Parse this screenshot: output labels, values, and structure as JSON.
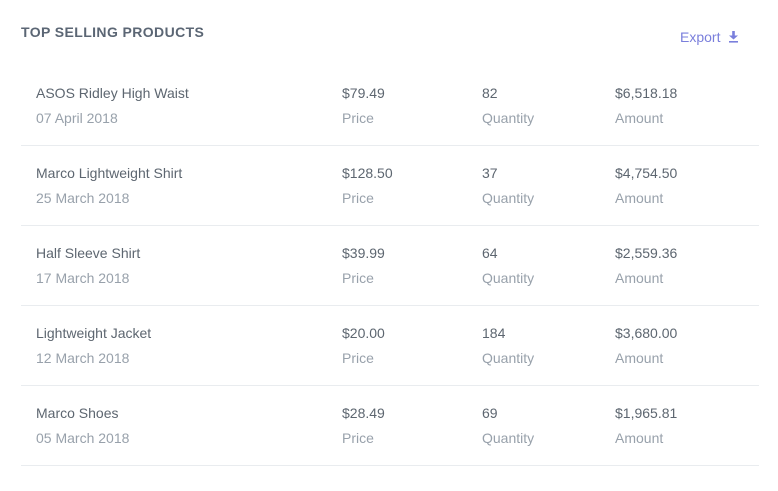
{
  "header": {
    "title": "TOP SELLING PRODUCTS",
    "export_label": "Export"
  },
  "products": [
    {
      "name": "ASOS Ridley High Waist",
      "date": "07 April 2018",
      "price": "$79.49",
      "price_label": "Price",
      "quantity": "82",
      "quantity_label": "Quantity",
      "amount": "$6,518.18",
      "amount_label": "Amount"
    },
    {
      "name": "Marco Lightweight Shirt",
      "date": "25 March 2018",
      "price": "$128.50",
      "price_label": "Price",
      "quantity": "37",
      "quantity_label": "Quantity",
      "amount": "$4,754.50",
      "amount_label": "Amount"
    },
    {
      "name": "Half Sleeve Shirt",
      "date": "17 March 2018",
      "price": "$39.99",
      "price_label": "Price",
      "quantity": "64",
      "quantity_label": "Quantity",
      "amount": "$2,559.36",
      "amount_label": "Amount"
    },
    {
      "name": "Lightweight Jacket",
      "date": "12 March 2018",
      "price": "$20.00",
      "price_label": "Price",
      "quantity": "184",
      "quantity_label": "Quantity",
      "amount": "$3,680.00",
      "amount_label": "Amount"
    },
    {
      "name": "Marco Shoes",
      "date": "05 March 2018",
      "price": "$28.49",
      "price_label": "Price",
      "quantity": "69",
      "quantity_label": "Quantity",
      "amount": "$1,965.81",
      "amount_label": "Amount"
    }
  ],
  "colors": {
    "accent": "#7a7fdc",
    "title": "#5b6674",
    "primary_text": "#5d6670",
    "secondary_text": "#98a1ab",
    "divider": "#e9ecef"
  },
  "icons": {
    "export": "download-icon"
  }
}
